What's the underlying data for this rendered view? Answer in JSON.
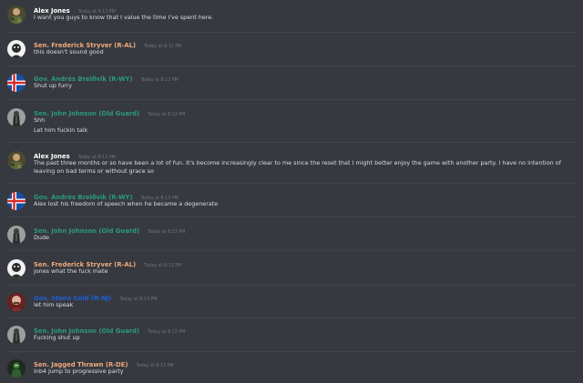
{
  "colors": {
    "background": "#36393f",
    "text": "#dcddde",
    "timestamp": "#72767d",
    "divider": "#40444b",
    "white_name": "#ffffff",
    "orange_name": "#f0a97b",
    "green_name": "#2c9a7a",
    "blue_name": "#1f5fd6"
  },
  "messages": [
    {
      "author": "Alex Jones",
      "color": "#ffffff",
      "time": "Today at 8:12 PM",
      "avatar": "camo-avatar-icon",
      "lines": [
        "I want you guys to know that I value the time I've spent here."
      ]
    },
    {
      "author": "Sen. Frederick Stryver (R-AL)",
      "color": "#f0a97b",
      "time": "Today at 8:12 PM",
      "avatar": "face-avatar-icon",
      "lines": [
        "this doesn't sound good"
      ]
    },
    {
      "author": "Gov. Andrés Breiðvik (R-WY)",
      "color": "#2c9a7a",
      "time": "Today at 8:12 PM",
      "avatar": "iceland-flag-avatar-icon",
      "lines": [
        "Shut up furry"
      ]
    },
    {
      "author": "Sen. John Johnson (Old Guard)",
      "color": "#2c9a7a",
      "time": "Today at 8:12 PM",
      "avatar": "soldier-avatar-icon",
      "lines": [
        "Shh",
        "Let him fuckin talk"
      ]
    },
    {
      "author": "Alex Jones",
      "color": "#ffffff",
      "time": "Today at 8:13 PM",
      "avatar": "camo-avatar-icon",
      "lines": [
        "The past three months or so have been a lot of fun. It's become increasingly clear to me since the reset that I might better enjoy the game with another party. I have no intention of leaving on bad terms or without grace so"
      ]
    },
    {
      "author": "Gov. Andrés Breiðvik (R-WY)",
      "color": "#2c9a7a",
      "time": "Today at 8:13 PM",
      "avatar": "iceland-flag-avatar-icon",
      "lines": [
        "Alex lost his freedom of speech when he became a degenerate"
      ]
    },
    {
      "author": "Sen. John Johnson (Old Guard)",
      "color": "#2c9a7a",
      "time": "Today at 8:13 PM",
      "avatar": "soldier-avatar-icon",
      "lines": [
        "Dude"
      ]
    },
    {
      "author": "Sen. Frederick Stryver (R-AL)",
      "color": "#f0a97b",
      "time": "Today at 8:13 PM",
      "avatar": "face-avatar-icon",
      "lines": [
        "jones what the fuck mate"
      ]
    },
    {
      "author": "Gov. Stone Cold (R-NJ)",
      "color": "#1f5fd6",
      "time": "Today at 8:13 PM",
      "avatar": "bald-man-avatar-icon",
      "lines": [
        "let him speak"
      ]
    },
    {
      "author": "Sen. John Johnson (Old Guard)",
      "color": "#2c9a7a",
      "time": "Today at 8:13 PM",
      "avatar": "soldier-avatar-icon",
      "lines": [
        "Fucking shut up"
      ]
    },
    {
      "author": "Sen. Jagged Thrawn (R-DE)",
      "color": "#f0a97b",
      "time": "Today at 8:13 PM",
      "avatar": "green-figure-avatar-icon",
      "lines": [
        "inb4 jump to progressive party"
      ]
    }
  ]
}
